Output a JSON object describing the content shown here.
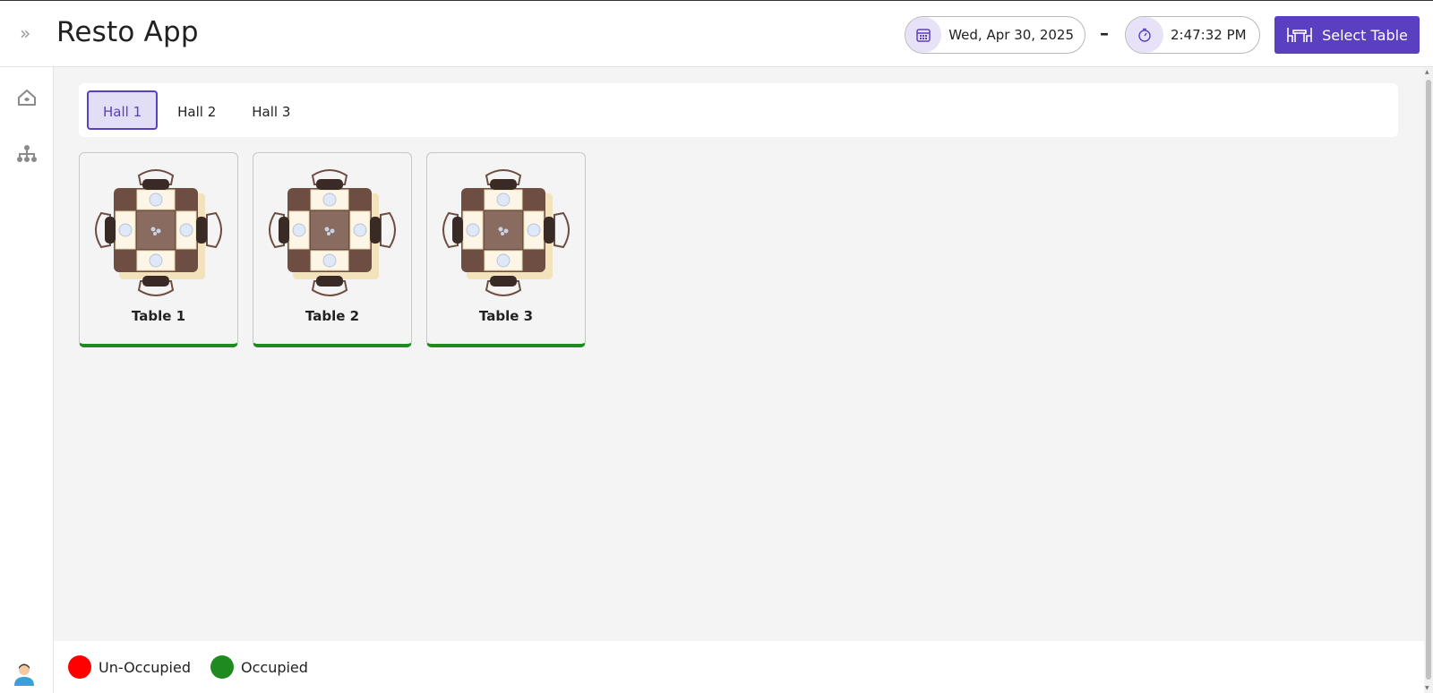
{
  "app": {
    "title": "Resto App"
  },
  "header": {
    "date": "Wed, Apr 30, 2025",
    "separator": "–",
    "time": "2:47:32 PM",
    "select_table_label": "Select Table"
  },
  "sidebar": {
    "items": [
      "home-icon",
      "hierarchy-icon"
    ]
  },
  "tabs": [
    {
      "label": "Hall 1",
      "active": true
    },
    {
      "label": "Hall 2",
      "active": false
    },
    {
      "label": "Hall 3",
      "active": false
    }
  ],
  "tables": [
    {
      "label": "Table 1",
      "status": "Occupied"
    },
    {
      "label": "Table 2",
      "status": "Occupied"
    },
    {
      "label": "Table 3",
      "status": "Occupied"
    }
  ],
  "legend": [
    {
      "label": "Un-Occupied",
      "color": "#ff0000"
    },
    {
      "label": "Occupied",
      "color": "#1f8a1f"
    }
  ],
  "colors": {
    "accent": "#5a3fc0",
    "occupied": "#1f8a1f",
    "unoccupied": "#ff0000"
  }
}
